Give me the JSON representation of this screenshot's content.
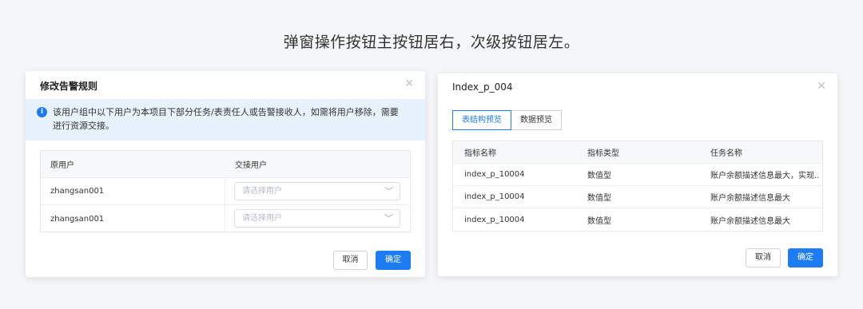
{
  "caption": "弹窗操作按钮主按钮居右，次级按钮居左。",
  "dialog1": {
    "title": "修改告警规则",
    "alert_line1": "该用户组中以下用户为本项目下部分任务/表责任人或告警接收人，如需将用户移除，需要",
    "alert_line2": "进行资源交接。",
    "columns": [
      "原用户",
      "交接用户"
    ],
    "rows": [
      {
        "user": "zhangsan001",
        "placeholder": "请选择用户"
      },
      {
        "user": "zhangsan001",
        "placeholder": "请选择用户"
      }
    ],
    "cancel_label": "取消",
    "ok_label": "确定"
  },
  "dialog2": {
    "title": "Index_p_004",
    "tabs": [
      "表结构预览",
      "数据预览"
    ],
    "columns": [
      "指标名称",
      "指标类型",
      "任务名称"
    ],
    "rows": [
      [
        "index_p_10004",
        "数值型",
        "账户余额描述信息最大，实现..."
      ],
      [
        "index_p_10004",
        "数值型",
        "账户余额描述信息最大"
      ],
      [
        "index_p_10004",
        "数值型",
        "账户余额描述信息最大"
      ]
    ],
    "cancel_label": "取消",
    "ok_label": "确定"
  },
  "colors": {
    "primary": "#1e7cf2",
    "alert_bg": "#e8f2fd",
    "page_bg": "#f5f6f8"
  },
  "icons": {
    "close": "close-icon",
    "info": "info-icon",
    "chevron": "chevron-down-icon"
  }
}
